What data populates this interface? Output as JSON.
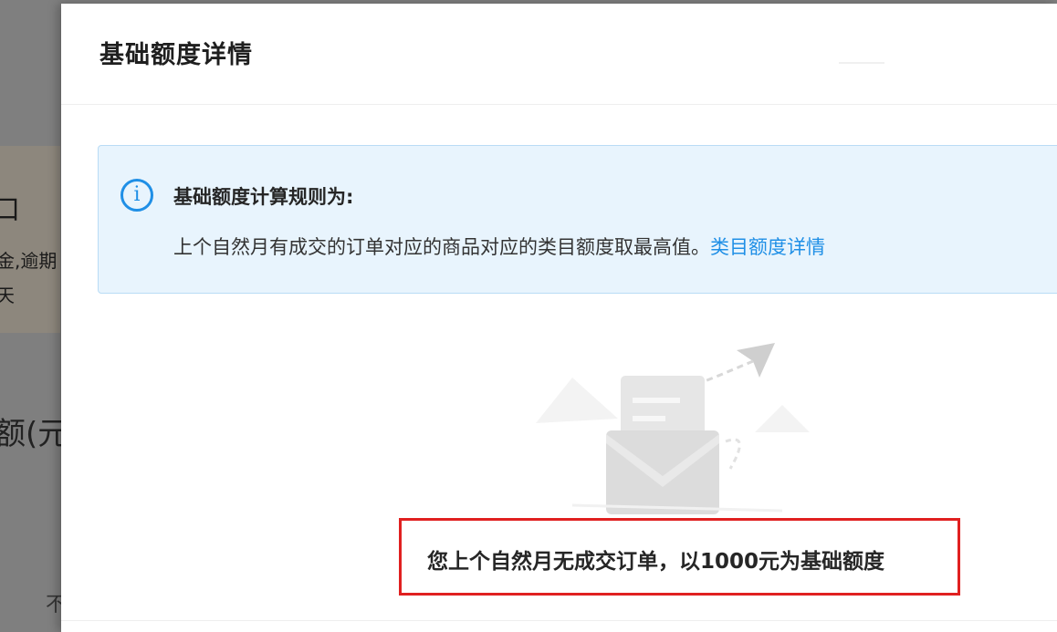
{
  "background": {
    "texts": [
      "口",
      "金,逾期",
      "天",
      "额(元",
      "不"
    ]
  },
  "modal": {
    "title": "基础额度详情",
    "alert": {
      "icon": "info-icon",
      "title": "基础额度计算规则为:",
      "description": "上个自然月有成交的订单对应的商品对应的类目额度取最高值。",
      "link_label": "类目额度详情"
    },
    "illustration": "empty-mail-illustration",
    "result_message": "您上个自然月无成交订单，以1000元为基础额度"
  },
  "colors": {
    "accent": "#1f8fe6",
    "alert_bg": "#e8f4fd",
    "highlight_border": "#e02020"
  }
}
